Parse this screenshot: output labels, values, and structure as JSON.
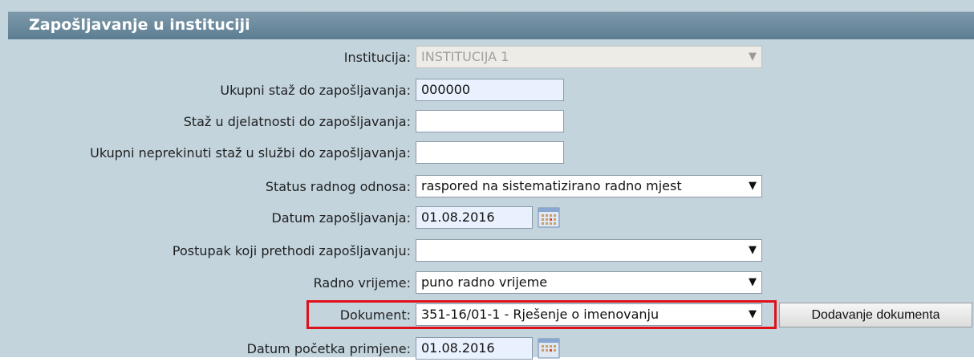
{
  "section": {
    "title": "Zapošljavanje u instituciji"
  },
  "fields": {
    "institucija": {
      "label": "Institucija:",
      "value": "INSTITUCIJA 1"
    },
    "ukupni_staz": {
      "label": "Ukupni staž do zapošljavanja:",
      "value": "000000"
    },
    "staz_djelatnost": {
      "label": "Staž u djelatnosti do zapošljavanja:",
      "value": ""
    },
    "neprekinuti_staz": {
      "label": "Ukupni neprekinuti staž u službi do zapošljavanja:",
      "value": ""
    },
    "status": {
      "label": "Status radnog odnosa:",
      "value": "raspored na sistematizirano radno mjest"
    },
    "datum_zaposljavanja": {
      "label": "Datum zapošljavanja:",
      "value": "01.08.2016"
    },
    "postupak": {
      "label": "Postupak koji prethodi zapošljavanju:",
      "value": ""
    },
    "radno_vrijeme": {
      "label": "Radno vrijeme:",
      "value": "puno radno vrijeme"
    },
    "dokument": {
      "label": "Dokument:",
      "value": "351-16/01-1 - Rješenje o imenovanju"
    },
    "datum_pocetka": {
      "label": "Datum početka primjene:",
      "value": "01.08.2016"
    }
  },
  "buttons": {
    "add_document": "Dodavanje dokumenta"
  },
  "icons": {
    "dropdown": "▼",
    "dropdown_arrow": "dropdown-arrow-icon",
    "calendar": "calendar-icon"
  },
  "colors": {
    "highlight": "#e0101a",
    "panel": "#c3d4dd",
    "title_bar": "#6a8a9e"
  }
}
